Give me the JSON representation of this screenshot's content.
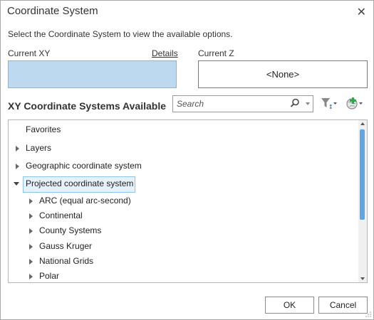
{
  "dialog": {
    "title": "Coordinate System",
    "close_glyph": "✕",
    "instruction": "Select the Coordinate System to view the available options."
  },
  "current_xy": {
    "label": "Current XY",
    "details_link": "Details",
    "value": ""
  },
  "current_z": {
    "label": "Current Z",
    "value": "<None>"
  },
  "available": {
    "heading": "XY Coordinate Systems Available",
    "search_placeholder": "Search",
    "filter_icon": "filter-icon",
    "add_icon": "globe-add-icon"
  },
  "tree": {
    "items": [
      {
        "label": "Favorites",
        "level": 0,
        "state": "none"
      },
      {
        "label": "Layers",
        "level": 0,
        "state": "collapsed"
      },
      {
        "label": "Geographic coordinate system",
        "level": 0,
        "state": "collapsed"
      },
      {
        "label": "Projected coordinate system",
        "level": 0,
        "state": "expanded",
        "selected": true
      },
      {
        "label": "ARC (equal arc-second)",
        "level": 1,
        "state": "collapsed"
      },
      {
        "label": "Continental",
        "level": 1,
        "state": "collapsed"
      },
      {
        "label": "County Systems",
        "level": 1,
        "state": "collapsed"
      },
      {
        "label": "Gauss Kruger",
        "level": 1,
        "state": "collapsed"
      },
      {
        "label": "National Grids",
        "level": 1,
        "state": "collapsed"
      },
      {
        "label": "Polar",
        "level": 1,
        "state": "collapsed"
      }
    ]
  },
  "buttons": {
    "ok": "OK",
    "cancel": "Cancel"
  },
  "colors": {
    "selection": "#e5f1fb",
    "xy_box": "#bcd9f0",
    "scroll_thumb": "#5ea7e4"
  }
}
